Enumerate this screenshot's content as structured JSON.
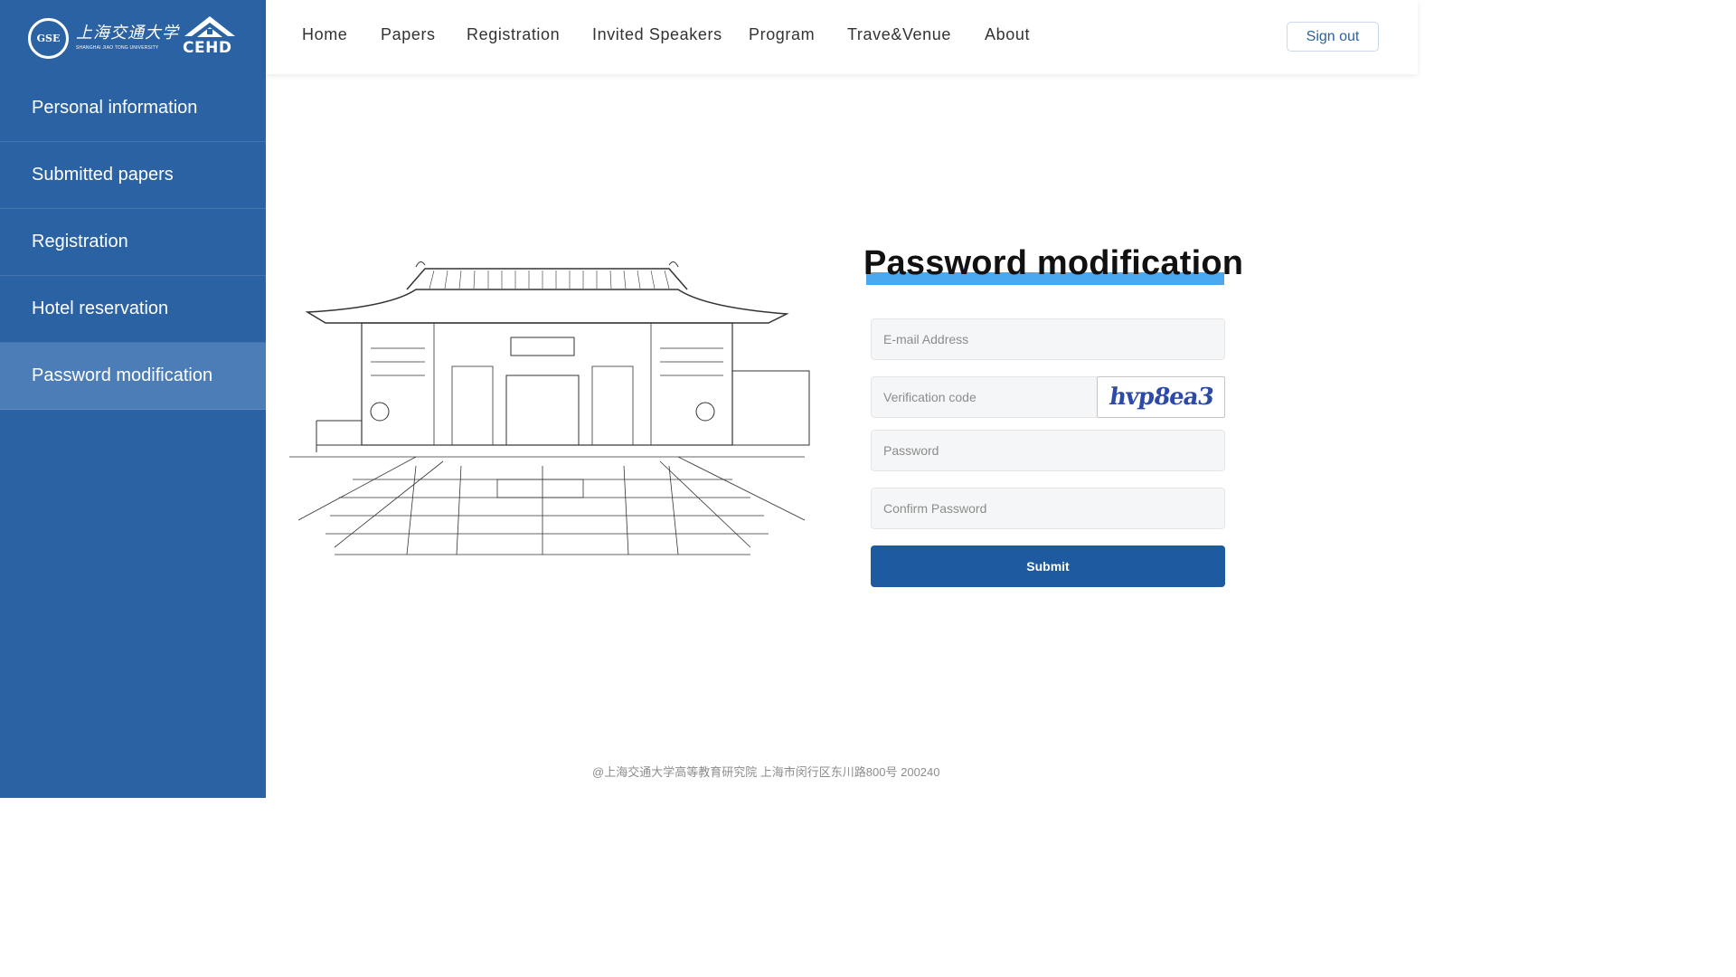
{
  "logo": {
    "seal_text": "GSE",
    "university_cn": "上海交通大学",
    "university_en": "SHANGHAI JIAO TONG UNIVERSITY",
    "cehd_text": "CEHD"
  },
  "sidebar": {
    "items": [
      {
        "label": "Personal information",
        "active": false
      },
      {
        "label": "Submitted papers",
        "active": false
      },
      {
        "label": "Registration",
        "active": false
      },
      {
        "label": "Hotel reservation",
        "active": false
      },
      {
        "label": "Password modification",
        "active": true
      }
    ]
  },
  "nav": {
    "items": [
      "Home",
      "Papers",
      "Registration",
      "Invited Speakers",
      "Program",
      "Trave&Venue",
      "About"
    ],
    "sign_out": "Sign out"
  },
  "form": {
    "title": "Password modification",
    "email_placeholder": "E-mail Address",
    "verification_placeholder": "Verification code",
    "captcha_text": "hvp8ea3",
    "password_placeholder": "Password",
    "confirm_placeholder": "Confirm Password",
    "submit_label": "Submit"
  },
  "footer": {
    "text": "@上海交通大学高等教育研究院   上海市闵行区东川路800号   200240"
  },
  "colors": {
    "sidebar": "#2b62a3",
    "sidebar_active": "#4d7db6",
    "accent": "#1e5aa0",
    "title_underline": "#4aa8f0"
  }
}
